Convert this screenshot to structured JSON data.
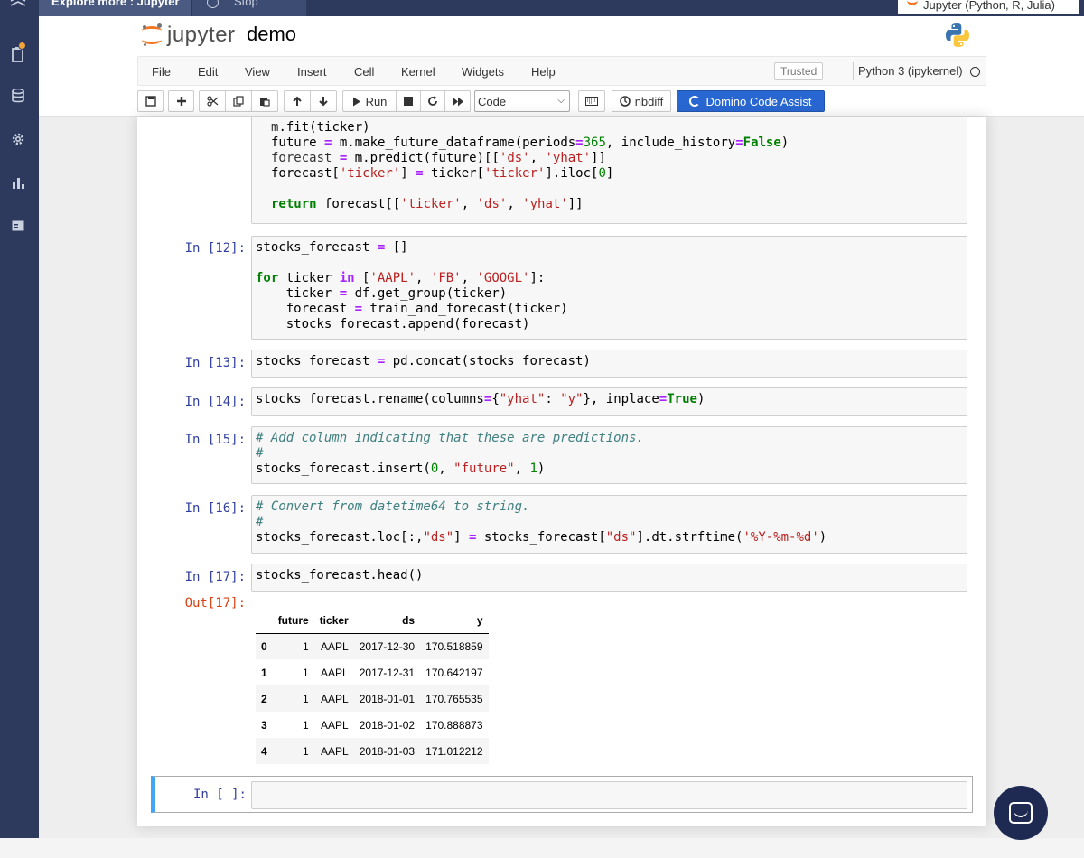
{
  "top_tabs": {
    "explore": "Explore more : Jupyter",
    "stop": "Stop",
    "kernel_tab": "Jupyter (Python, R, Julia)"
  },
  "header": {
    "logo_text": "jupyter",
    "notebook_name": "demo"
  },
  "menu": [
    "File",
    "Edit",
    "View",
    "Insert",
    "Cell",
    "Kernel",
    "Widgets",
    "Help"
  ],
  "trusted": "Trusted",
  "kernel_name": "Python 3 (ipykernel)",
  "toolbar": {
    "run_label": "Run",
    "cell_type": "Code",
    "nbdiff_label": "nbdiff",
    "domino_label": "Domino Code Assist"
  },
  "cells": {
    "c12": "In [12]:",
    "c13": "In [13]:",
    "c14": "In [14]:",
    "c15": "In [15]:",
    "c16": "In [16]:",
    "c17": "In [17]:",
    "out17": "Out[17]:",
    "empty": "In [ ]:"
  },
  "table": {
    "columns": [
      "",
      "future",
      "ticker",
      "ds",
      "y"
    ],
    "rows": [
      [
        "0",
        "1",
        "AAPL",
        "2017-12-30",
        "170.518859"
      ],
      [
        "1",
        "1",
        "AAPL",
        "2017-12-31",
        "170.642197"
      ],
      [
        "2",
        "1",
        "AAPL",
        "2018-01-01",
        "170.765535"
      ],
      [
        "3",
        "1",
        "AAPL",
        "2018-01-02",
        "170.888873"
      ],
      [
        "4",
        "1",
        "AAPL",
        "2018-01-03",
        "171.012212"
      ]
    ]
  },
  "colors": {
    "rail": "#2d3a5e",
    "accent_blue": "#2866d1",
    "prompt_in": "#303f9f",
    "prompt_out": "#d84315",
    "selected_cell": "#42a5f5"
  }
}
